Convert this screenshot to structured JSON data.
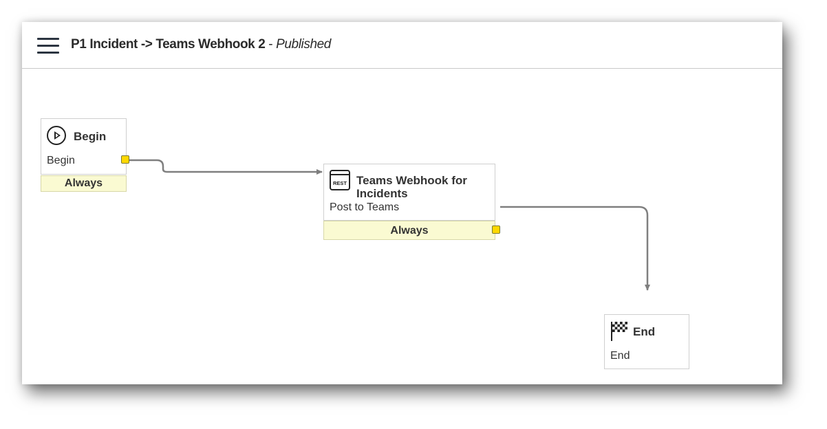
{
  "header": {
    "title": "P1 Incident -> Teams Webhook 2",
    "separator": " - ",
    "status": "Published",
    "menu_icon": "hamburger-menu-icon"
  },
  "nodes": {
    "begin": {
      "title": "Begin",
      "subtitle": "Begin",
      "condition": "Always",
      "icon": "play-circle-icon"
    },
    "webhook": {
      "title_line1": "Teams Webhook for",
      "title_line2": "Incidents",
      "subtitle": "Post to Teams",
      "condition": "Always",
      "icon": "rest-icon",
      "icon_text": "REST"
    },
    "end": {
      "title": "End",
      "subtitle": "End",
      "icon": "checkered-flag-icon"
    }
  },
  "colors": {
    "condition_bg": "#fafad2",
    "port": "#ffd800",
    "connector": "#7f7f7f",
    "text": "#333333"
  }
}
